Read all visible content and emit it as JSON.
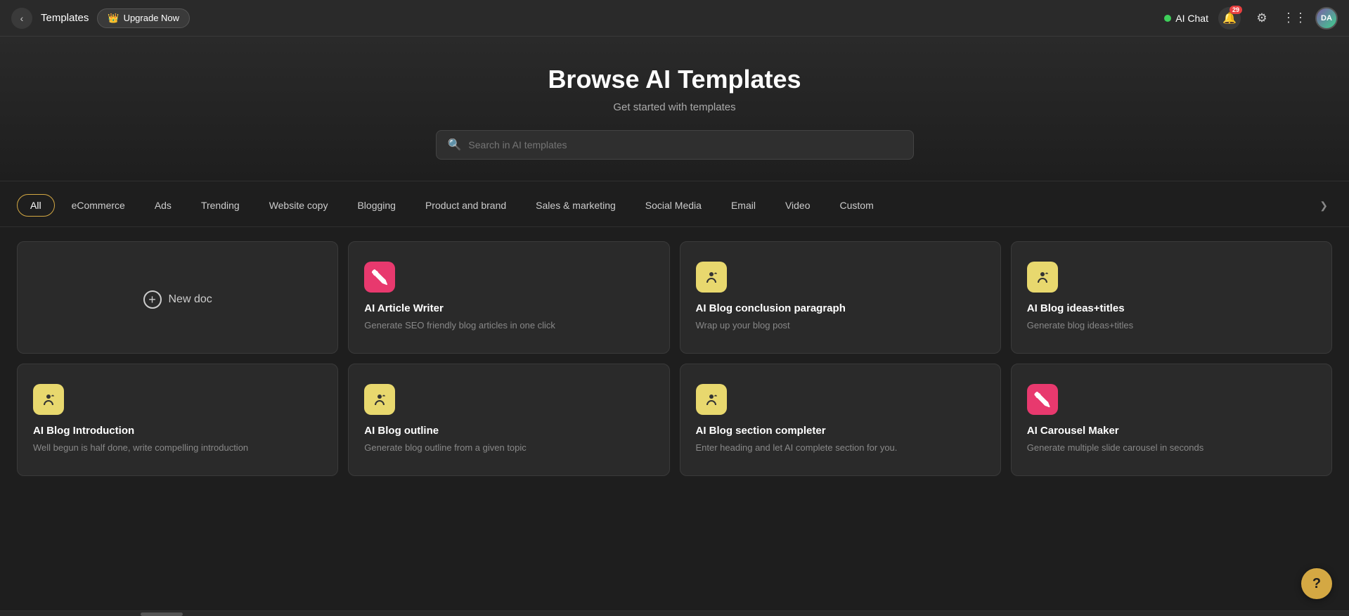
{
  "topnav": {
    "back_label": "←",
    "title": "Templates",
    "upgrade_label": "Upgrade Now",
    "upgrade_icon": "👑",
    "ai_chat_label": "AI Chat",
    "notif_count": "29",
    "avatar_initials": "DA",
    "settings_icon": "⚙",
    "grid_icon": "⋮⋮"
  },
  "hero": {
    "title": "Browse AI Templates",
    "subtitle": "Get started with templates",
    "search_placeholder": "Search in AI templates"
  },
  "filter_tabs": [
    {
      "id": "all",
      "label": "All",
      "active": true
    },
    {
      "id": "ecommerce",
      "label": "eCommerce",
      "active": false
    },
    {
      "id": "ads",
      "label": "Ads",
      "active": false
    },
    {
      "id": "trending",
      "label": "Trending",
      "active": false
    },
    {
      "id": "website-copy",
      "label": "Website copy",
      "active": false
    },
    {
      "id": "blogging",
      "label": "Blogging",
      "active": false
    },
    {
      "id": "product-brand",
      "label": "Product and brand",
      "active": false
    },
    {
      "id": "sales-marketing",
      "label": "Sales & marketing",
      "active": false
    },
    {
      "id": "social-media",
      "label": "Social Media",
      "active": false
    },
    {
      "id": "email",
      "label": "Email",
      "active": false
    },
    {
      "id": "video",
      "label": "Video",
      "active": false
    },
    {
      "id": "custom",
      "label": "Custom",
      "active": false
    }
  ],
  "cards": [
    {
      "id": "new-doc",
      "type": "new-doc",
      "label": "New doc"
    },
    {
      "id": "ai-article-writer",
      "type": "template",
      "icon_style": "pink",
      "icon": "✏️",
      "title": "AI Article Writer",
      "description": "Generate SEO friendly blog articles in one click"
    },
    {
      "id": "ai-blog-conclusion",
      "type": "template",
      "icon_style": "yellow",
      "icon": "🎙",
      "title": "AI Blog conclusion paragraph",
      "description": "Wrap up your blog post"
    },
    {
      "id": "ai-blog-ideas-titles",
      "type": "template",
      "icon_style": "yellow",
      "icon": "🎙",
      "title": "AI Blog ideas+titles",
      "description": "Generate blog ideas+titles"
    },
    {
      "id": "ai-blog-introduction",
      "type": "template",
      "icon_style": "yellow",
      "icon": "🎙",
      "title": "AI Blog Introduction",
      "description": "Well begun is half done, write compelling introduction"
    },
    {
      "id": "ai-blog-outline",
      "type": "template",
      "icon_style": "yellow",
      "icon": "🎙",
      "title": "AI Blog outline",
      "description": "Generate blog outline from a given topic"
    },
    {
      "id": "ai-blog-section-completer",
      "type": "template",
      "icon_style": "yellow",
      "icon": "🎙",
      "title": "AI Blog section completer",
      "description": "Enter heading and let AI complete section for you."
    },
    {
      "id": "ai-carousel-maker",
      "type": "template",
      "icon_style": "pink",
      "icon": "✏️",
      "title": "AI Carousel Maker",
      "description": "Generate multiple slide carousel in seconds"
    }
  ],
  "help": {
    "label": "?"
  }
}
